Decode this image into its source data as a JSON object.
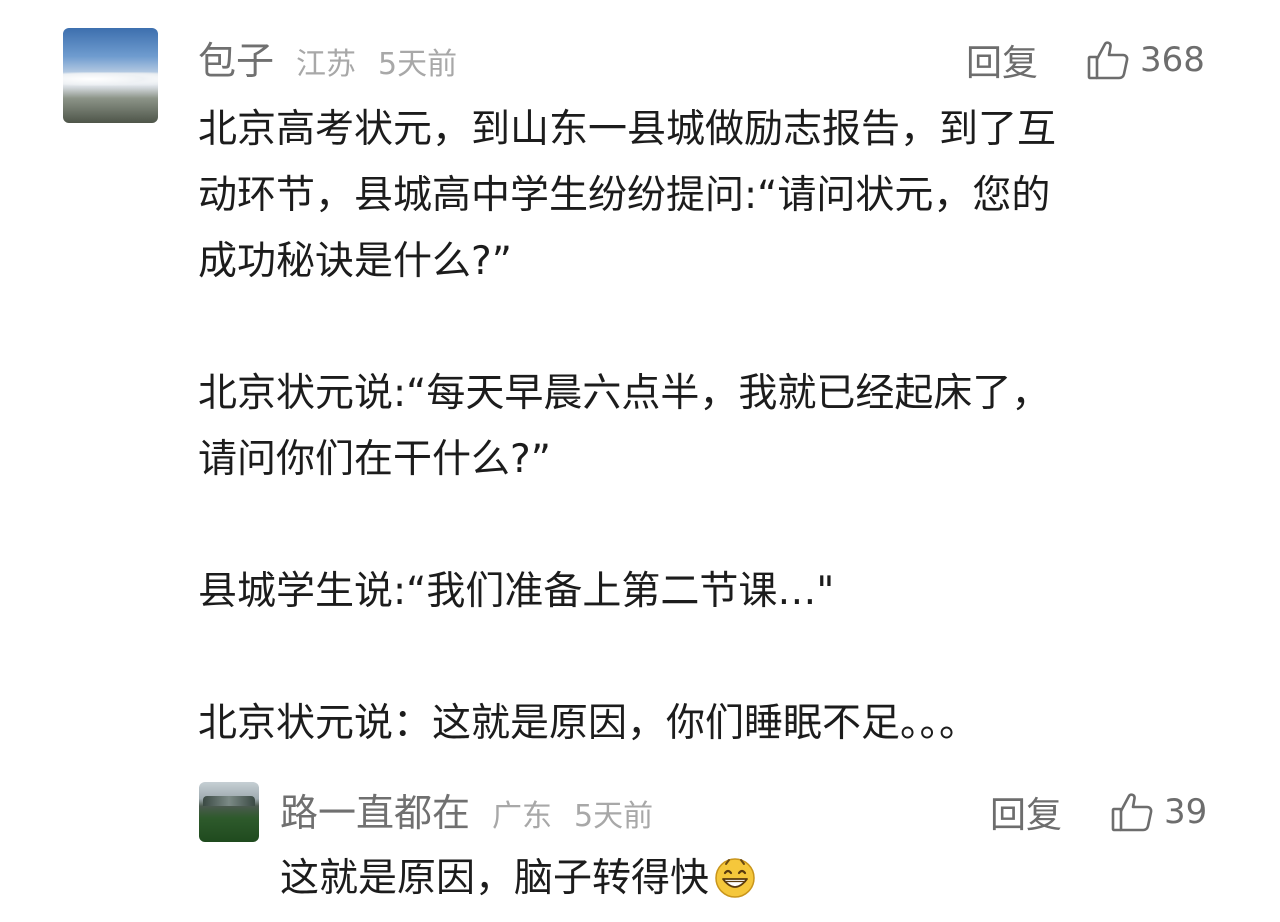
{
  "comment": {
    "username": "包子",
    "location": "江苏",
    "time": "5天前",
    "reply_label": "回复",
    "like_count": "368",
    "paragraphs": [
      [
        "北京高考状元，到山东一县城做励志报告，到了互",
        "动环节，县城高中学生纷纷提问:“请问状元，您的",
        "成功秘诀是什么?”"
      ],
      [
        "北京状元说:“每天早晨六点半，我就已经起床了，",
        "请问你们在干什么?”"
      ],
      [
        "县城学生说:“我们准备上第二节课…\""
      ],
      [
        "北京状元说：这就是原因，你们睡眠不足。。。"
      ]
    ]
  },
  "reply": {
    "username": "路一直都在",
    "location": "广东",
    "time": "5天前",
    "reply_label": "回复",
    "like_count": "39",
    "text": "这就是原因，脑子转得快",
    "emoji": "grinning-face-icon"
  },
  "colors": {
    "username": "#707070",
    "meta": "#a8a8a8",
    "body": "#1c1c1c",
    "action": "#6d6d6d"
  }
}
